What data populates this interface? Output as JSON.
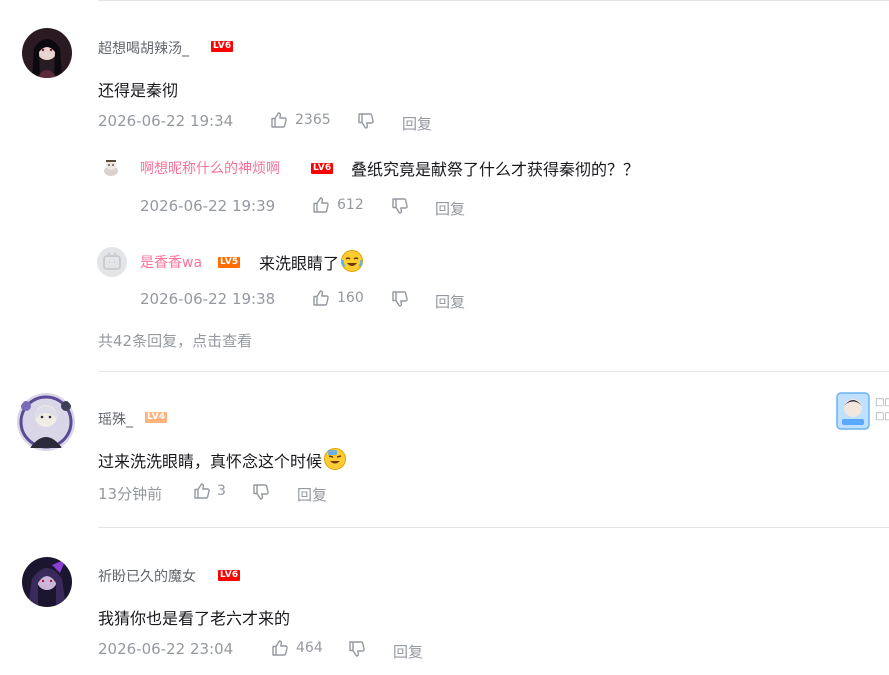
{
  "comments": [
    {
      "username": "超想喝胡辣汤_",
      "level": "LV6",
      "content": "还得是秦彻",
      "time": "2026-06-22 19:34",
      "likes": "2365",
      "reply_label": "回复",
      "replies": [
        {
          "username": "啊想昵称什么的神烦啊",
          "level": "LV6",
          "content": "叠纸究竟是献祭了什么才获得秦彻的？？",
          "time": "2026-06-22 19:39",
          "likes": "612",
          "reply_label": "回复"
        },
        {
          "username": "是香香wa",
          "level": "LV5",
          "content": "来洗眼睛了",
          "emoji": "crying-laugh-emoji",
          "time": "2026-06-22 19:38",
          "likes": "160",
          "reply_label": "回复"
        }
      ],
      "more_replies": "共42条回复，点击查看"
    },
    {
      "username": "瑶殊_",
      "level": "LV4",
      "content": "过来洗洗眼睛，真怀念这个时候",
      "emoji": "sweat-smile-emoji",
      "time": "13分钟前",
      "likes": "3",
      "reply_label": "回复",
      "fan_badge_text": [
        "□□",
        "□□"
      ]
    },
    {
      "username": "祈盼已久的魔女",
      "level": "LV6",
      "content": "我猜你也是看了老六才来的",
      "time": "2026-06-22 23:04",
      "likes": "464",
      "reply_label": "回复"
    }
  ],
  "colors": {
    "pink_name": "#fb7299",
    "meta_gray": "#9499a0",
    "lv6": "#ff0000",
    "lv5": "#ff6c00",
    "lv4": "#ffb37c"
  }
}
